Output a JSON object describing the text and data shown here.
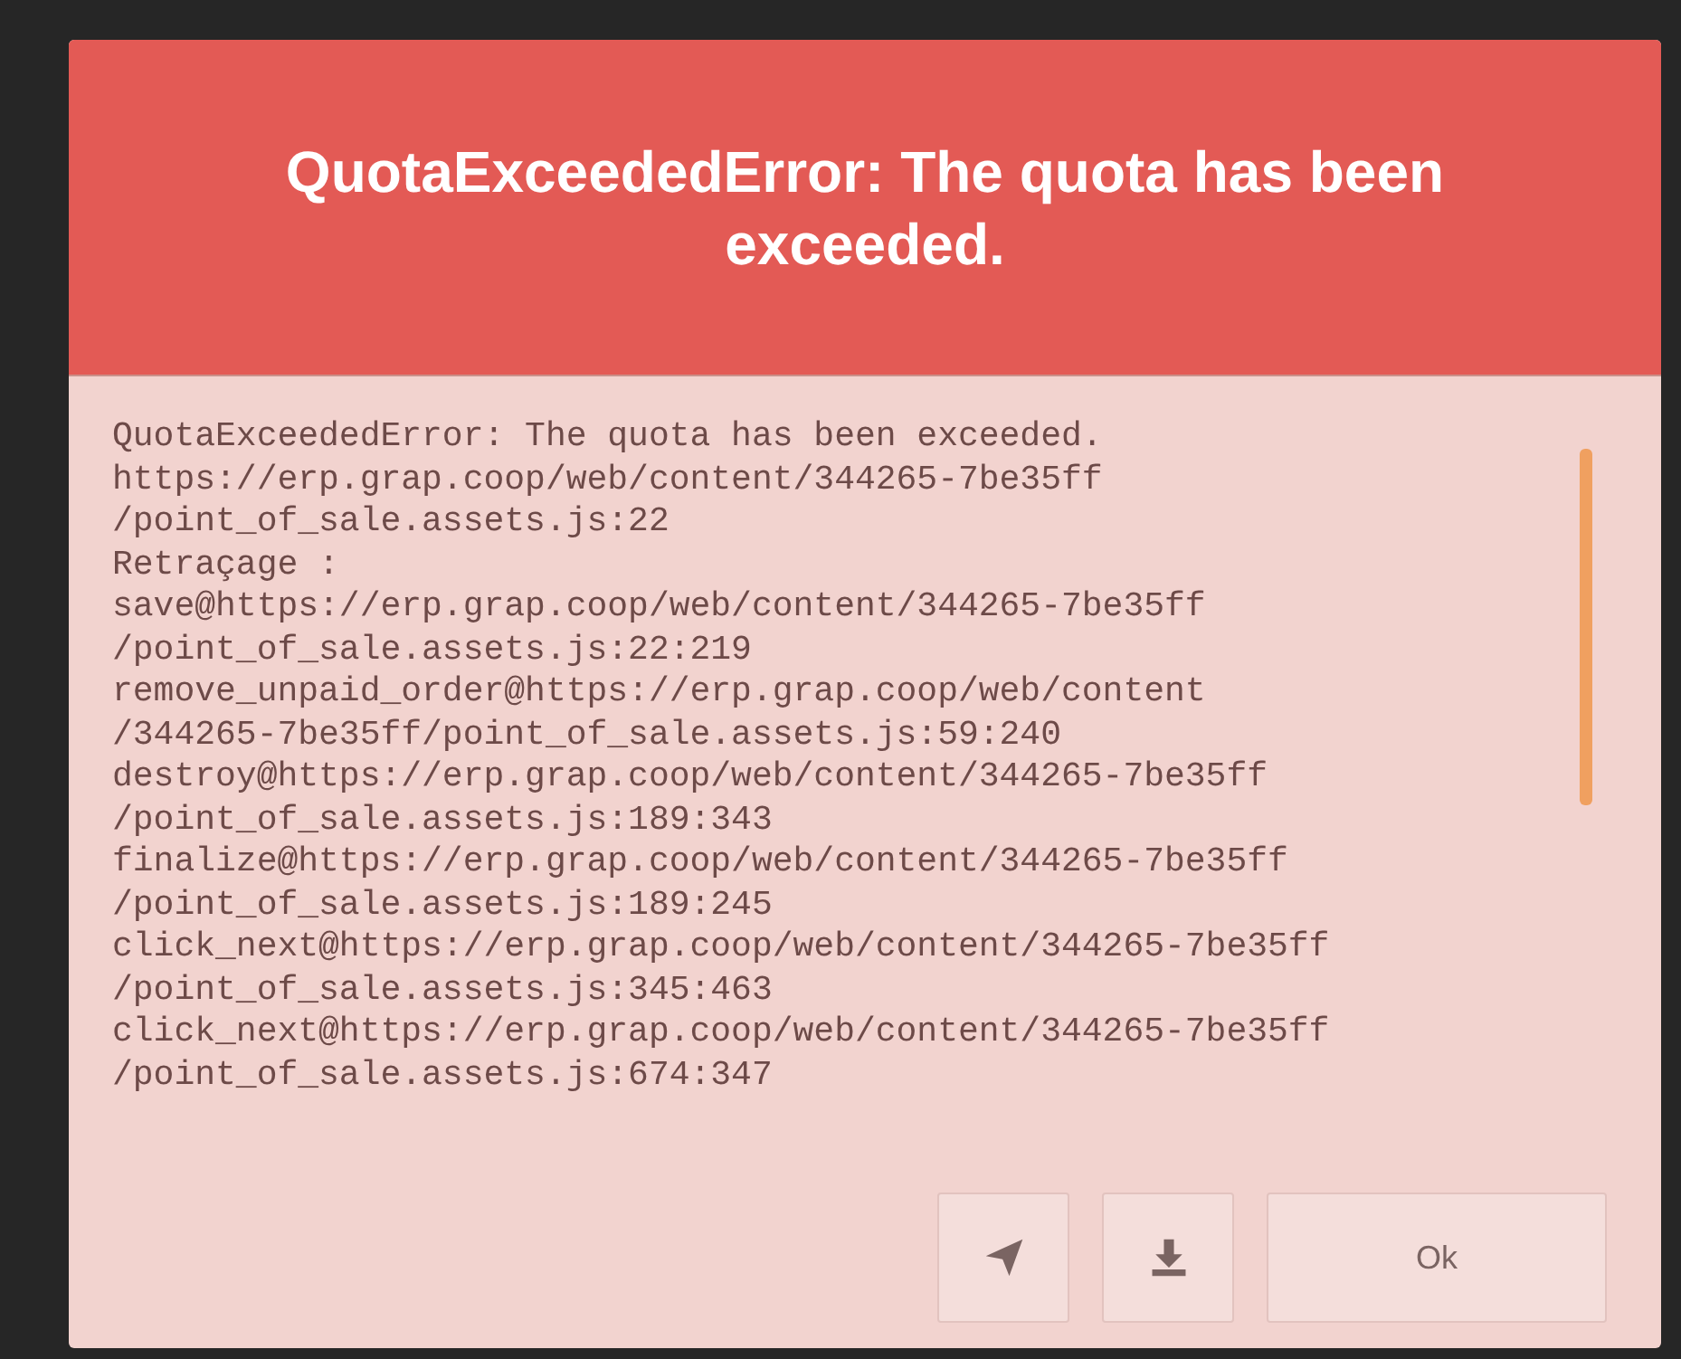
{
  "dialog": {
    "title": "QuotaExceededError: The quota has been exceeded.",
    "trace": [
      "QuotaExceededError: The quota has been exceeded.",
      "https://erp.grap.coop/web/content/344265-7be35ff",
      "/point_of_sale.assets.js:22",
      "Retraçage :",
      "save@https://erp.grap.coop/web/content/344265-7be35ff",
      "/point_of_sale.assets.js:22:219",
      "remove_unpaid_order@https://erp.grap.coop/web/content",
      "/344265-7be35ff/point_of_sale.assets.js:59:240",
      "destroy@https://erp.grap.coop/web/content/344265-7be35ff",
      "/point_of_sale.assets.js:189:343",
      "finalize@https://erp.grap.coop/web/content/344265-7be35ff",
      "/point_of_sale.assets.js:189:245",
      "click_next@https://erp.grap.coop/web/content/344265-7be35ff",
      "/point_of_sale.assets.js:345:463",
      "click_next@https://erp.grap.coop/web/content/344265-7be35ff",
      "/point_of_sale.assets.js:674:347"
    ],
    "buttons": [
      {
        "kind": "send"
      },
      {
        "kind": "download"
      },
      {
        "kind": "text",
        "label": "Ok"
      }
    ]
  }
}
